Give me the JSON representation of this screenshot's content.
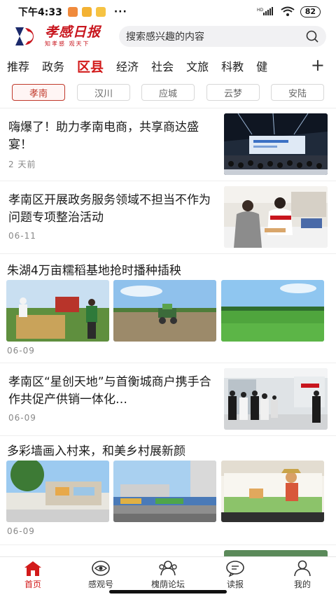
{
  "status_bar": {
    "time": "下午4:33",
    "signal_label": "HD",
    "battery": "82"
  },
  "header": {
    "logo_title": "孝感日报",
    "logo_slogan": "知孝感 观天下",
    "search_placeholder": "搜索感兴趣的内容",
    "brand_color": "#c8161e"
  },
  "channels": {
    "items": [
      "推荐",
      "政务",
      "区县",
      "经济",
      "社会",
      "文旅",
      "科教",
      "健"
    ],
    "active_index": 2,
    "plus_label": "+"
  },
  "counties": {
    "items": [
      "孝南",
      "汉川",
      "应城",
      "云梦",
      "安陆"
    ],
    "active_index": 0,
    "accent": "#c0392b"
  },
  "news": [
    {
      "title": "嗨爆了！助力孝南电商，共享商达盛宴！",
      "meta": "2 天前",
      "layout": "right-thumb"
    },
    {
      "title": "孝南区开展政务服务领域不担当不作为问题专项整治活动",
      "meta": "06-11",
      "layout": "right-thumb"
    },
    {
      "title": "朱湖4万亩糯稻基地抢时播种插秧",
      "meta": "06-09",
      "layout": "three-images"
    },
    {
      "title": "孝南区“星创天地”与首衡城商户携手合作共促产供销一体化…",
      "meta": "06-09",
      "layout": "right-thumb"
    },
    {
      "title": "多彩墙画入村来，和美乡村展新颜",
      "meta": "06-09",
      "layout": "three-images"
    }
  ],
  "bottom_nav": {
    "items": [
      {
        "label": "首页",
        "icon": "home-icon"
      },
      {
        "label": "感观号",
        "icon": "eye-badge-icon"
      },
      {
        "label": "槐荫论坛",
        "icon": "forum-icon"
      },
      {
        "label": "读报",
        "icon": "chat-bubble-icon"
      },
      {
        "label": "我的",
        "icon": "person-icon"
      }
    ],
    "active_index": 0,
    "active_color": "#d21a1a"
  }
}
